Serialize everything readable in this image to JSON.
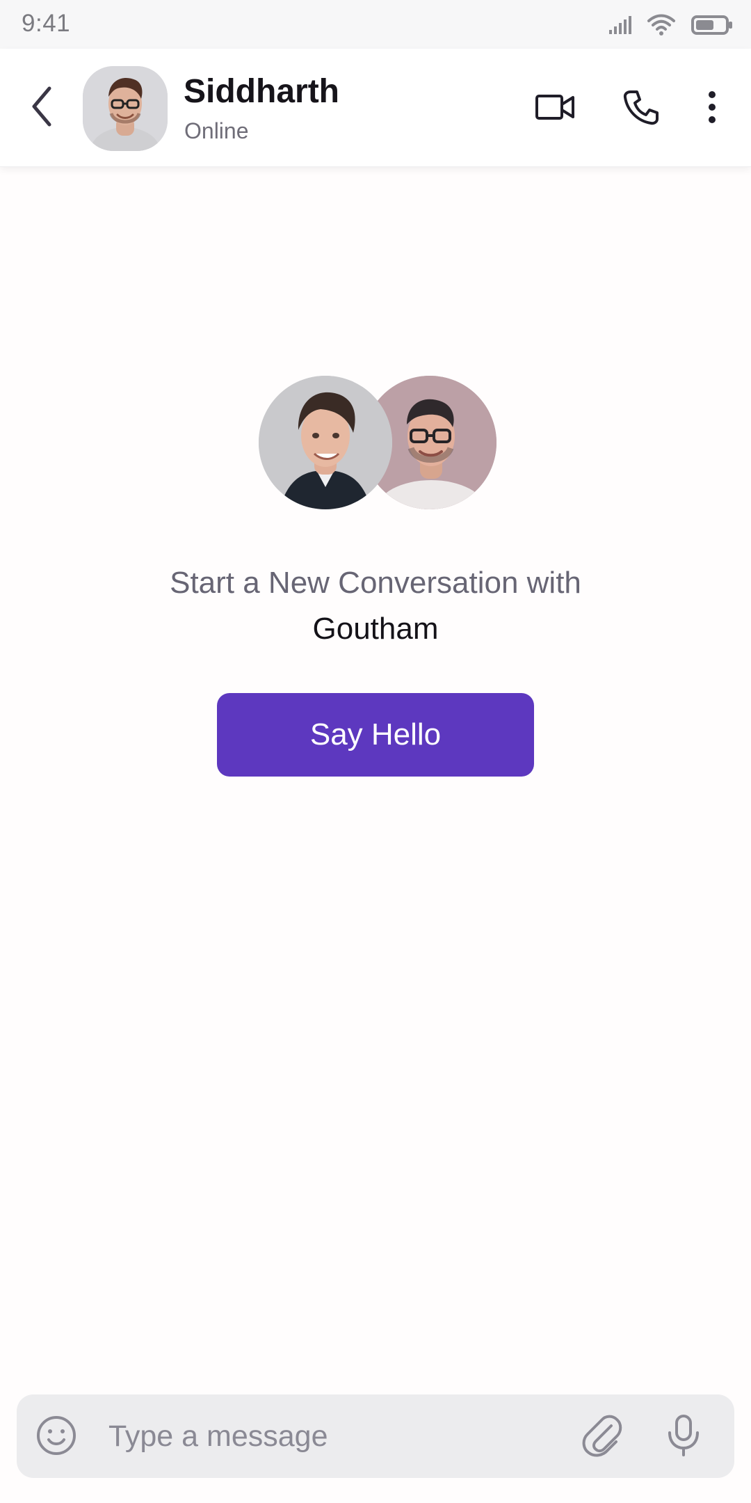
{
  "status_bar": {
    "time": "9:41",
    "icons": [
      "signal-icon",
      "wifi-icon",
      "battery-icon"
    ]
  },
  "header": {
    "back_icon": "chevron-left-icon",
    "contact_name": "Siddharth",
    "contact_status": "Online",
    "actions": [
      "video-camera-icon",
      "phone-icon",
      "more-vertical-icon"
    ]
  },
  "empty_state": {
    "prompt": "Start a New Conversation with",
    "contact_name": "Goutham",
    "button_label": "Say Hello"
  },
  "composer": {
    "placeholder": "Type a message",
    "icons": [
      "emoji-icon",
      "paperclip-icon",
      "microphone-icon"
    ]
  },
  "colors": {
    "accent": "#5d38bf",
    "header_text": "#16141a",
    "secondary_text": "#6f6d78",
    "composer_background": "#ececee"
  }
}
